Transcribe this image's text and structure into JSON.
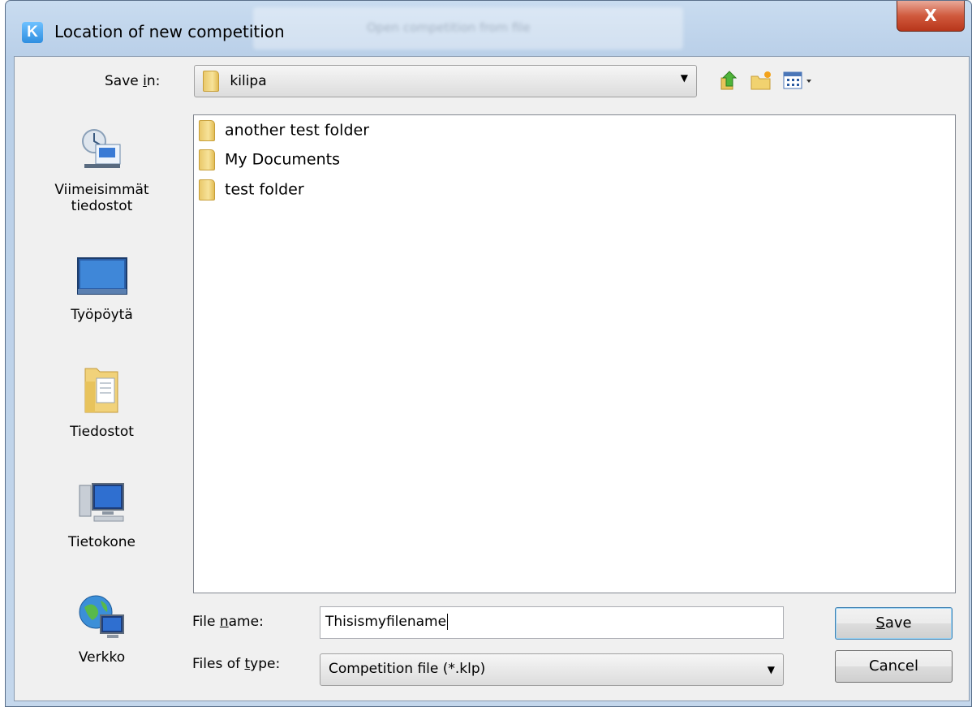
{
  "window": {
    "title": "Location of new competition",
    "app_icon_letter": "K",
    "background_title": "Open competition from file",
    "close_symbol": "X"
  },
  "save_in": {
    "label_pre": "Save ",
    "label_underline": "i",
    "label_post": "n:",
    "value": "kilipa"
  },
  "places": [
    {
      "label": "Viimeisimmät tiedostot",
      "icon": "recent-files-icon"
    },
    {
      "label": "Työpöytä",
      "icon": "desktop-icon"
    },
    {
      "label": "Tiedostot",
      "icon": "documents-icon"
    },
    {
      "label": "Tietokone",
      "icon": "computer-icon"
    },
    {
      "label": "Verkko",
      "icon": "network-icon"
    }
  ],
  "files": [
    {
      "name": "another test folder",
      "icon": "folder-icon"
    },
    {
      "name": "My Documents",
      "icon": "folder-icon"
    },
    {
      "name": "test folder",
      "icon": "folder-icon"
    }
  ],
  "file_name": {
    "label_pre": "File ",
    "label_underline": "n",
    "label_post": "ame:",
    "value": "Thisismyfilename"
  },
  "file_type": {
    "label_pre": "Files of ",
    "label_underline": "t",
    "label_post": "ype:",
    "value": "Competition file (*.klp)"
  },
  "buttons": {
    "save_underline": "S",
    "save_rest": "ave",
    "cancel": "Cancel"
  },
  "colors": {
    "accent": "#3c7fb1",
    "close_button": "#c8472b",
    "folder": "#f0d47a"
  }
}
